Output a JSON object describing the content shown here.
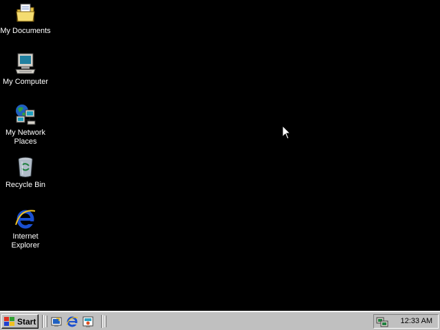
{
  "desktop": {
    "icons": [
      {
        "label": "My Documents",
        "icon": "folder-documents-icon"
      },
      {
        "label": "My Computer",
        "icon": "computer-icon"
      },
      {
        "label": "My Network\nPlaces",
        "icon": "network-places-icon"
      },
      {
        "label": "Recycle Bin",
        "icon": "recycle-bin-icon"
      },
      {
        "label": "Internet\nExplorer",
        "icon": "internet-explorer-icon"
      }
    ],
    "background_color": "#000000"
  },
  "taskbar": {
    "start_label": "Start",
    "quick_launch": [
      {
        "icon": "show-desktop-icon"
      },
      {
        "icon": "internet-explorer-icon"
      },
      {
        "icon": "channels-icon"
      }
    ],
    "tray": {
      "icon": "network-tray-icon",
      "clock": "12:33 AM"
    },
    "background_color": "#c0c0c0"
  }
}
